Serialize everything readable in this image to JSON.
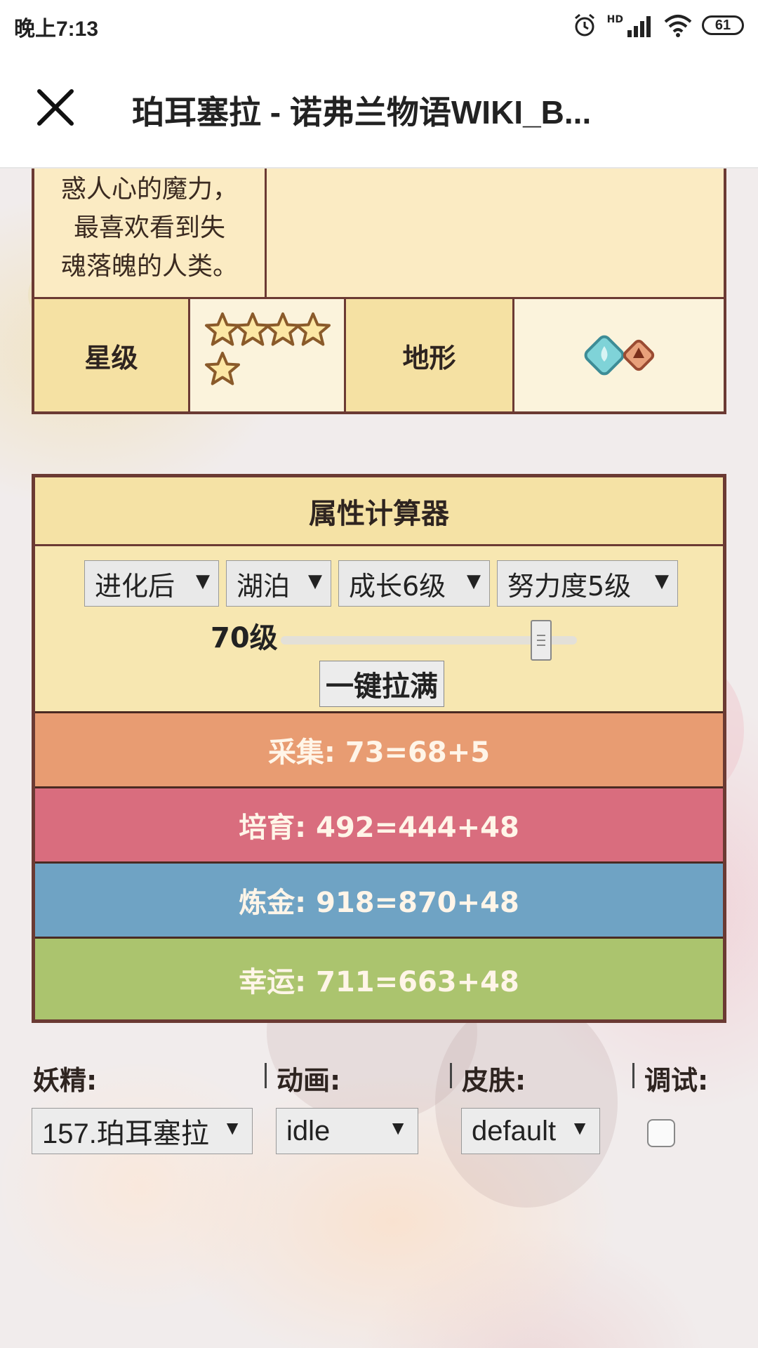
{
  "status_bar": {
    "time": "晚上7:13",
    "battery": "61",
    "network": "HD"
  },
  "header": {
    "title": "珀耳塞拉 - 诺弗兰物语WIKI_B..."
  },
  "info_table": {
    "description_lines": [
      "惑人心的魔力，",
      "最喜欢看到失",
      "魂落魄的人类。"
    ],
    "star_label": "星级",
    "star_count": 5,
    "terrain_label": "地形",
    "terrain_icons": [
      "water-terrain-icon",
      "fire-terrain-icon"
    ]
  },
  "calculator": {
    "title": "属性计算器",
    "selects": [
      {
        "value": "进化后"
      },
      {
        "value": "湖泊"
      },
      {
        "value": "成长6级"
      },
      {
        "value": "努力度5级"
      }
    ],
    "level_label": "70级",
    "level_value": 70,
    "level_max": 70,
    "fill_button": "一键拉满",
    "stats": [
      {
        "label": "采集: 73=68+5",
        "color": "#e89c72"
      },
      {
        "label": "培育: 492=444+48",
        "color": "#d96d7e"
      },
      {
        "label": "炼金: 918=870+48",
        "color": "#6fa3c4"
      },
      {
        "label": "幸运: 711=663+48",
        "color": "#abc46e"
      }
    ]
  },
  "bottom": {
    "fairy_label": "妖精:",
    "animation_label": "动画:",
    "skin_label": "皮肤:",
    "debug_label": "调试:",
    "fairy_value": "157.珀耳塞拉",
    "animation_value": "idle",
    "skin_value": "default",
    "debug_checked": false
  }
}
